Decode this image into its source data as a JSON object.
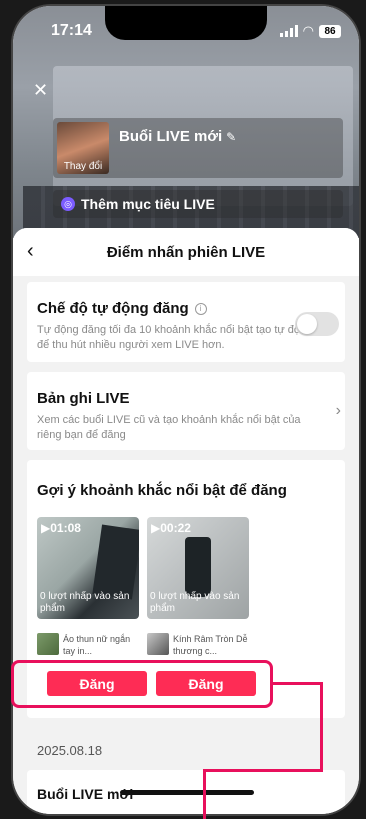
{
  "status_bar": {
    "time": "17:14",
    "battery": "86"
  },
  "live_setup": {
    "close": "✕",
    "thumbnail_label": "Thay đổi",
    "live_title": "Buổi LIVE mới",
    "goal_label": "Thêm mục tiêu LIVE"
  },
  "sheet": {
    "title": "Điểm nhấn phiên LIVE",
    "auto_post": {
      "title": "Chế độ tự động đăng",
      "description": "Tự động đăng tối đa 10 khoảnh khắc nổi bật tạo tự động để thu hút nhiều người xem LIVE hơn.",
      "enabled": false
    },
    "live_record": {
      "title": "Bản ghi LIVE",
      "description": "Xem các buổi LIVE cũ và tạo khoảnh khắc nổi bật của riêng bạn để đăng"
    },
    "suggestions": {
      "title": "Gợi ý khoảnh khắc nổi bật để đăng",
      "videos": [
        {
          "duration": "01:08",
          "caption": "0 lượt nhấp vào sản phẩm"
        },
        {
          "duration": "00:22",
          "caption": "0 lượt nhấp vào sản phẩm"
        }
      ],
      "products": [
        {
          "name": "Áo thun nữ ngắn tay in..."
        },
        {
          "name": "Kính Râm Tròn Dễ thương c..."
        }
      ],
      "post_button": "Đăng"
    },
    "date": "2025.08.18",
    "session_title": "Buổi LIVE mới"
  },
  "colors": {
    "accent": "#fe2c55",
    "annotation": "#e8105c"
  },
  "icons": [
    "close-icon",
    "pencil-icon",
    "goal-icon",
    "back-icon",
    "info-icon",
    "chevron-right-icon",
    "play-icon"
  ]
}
